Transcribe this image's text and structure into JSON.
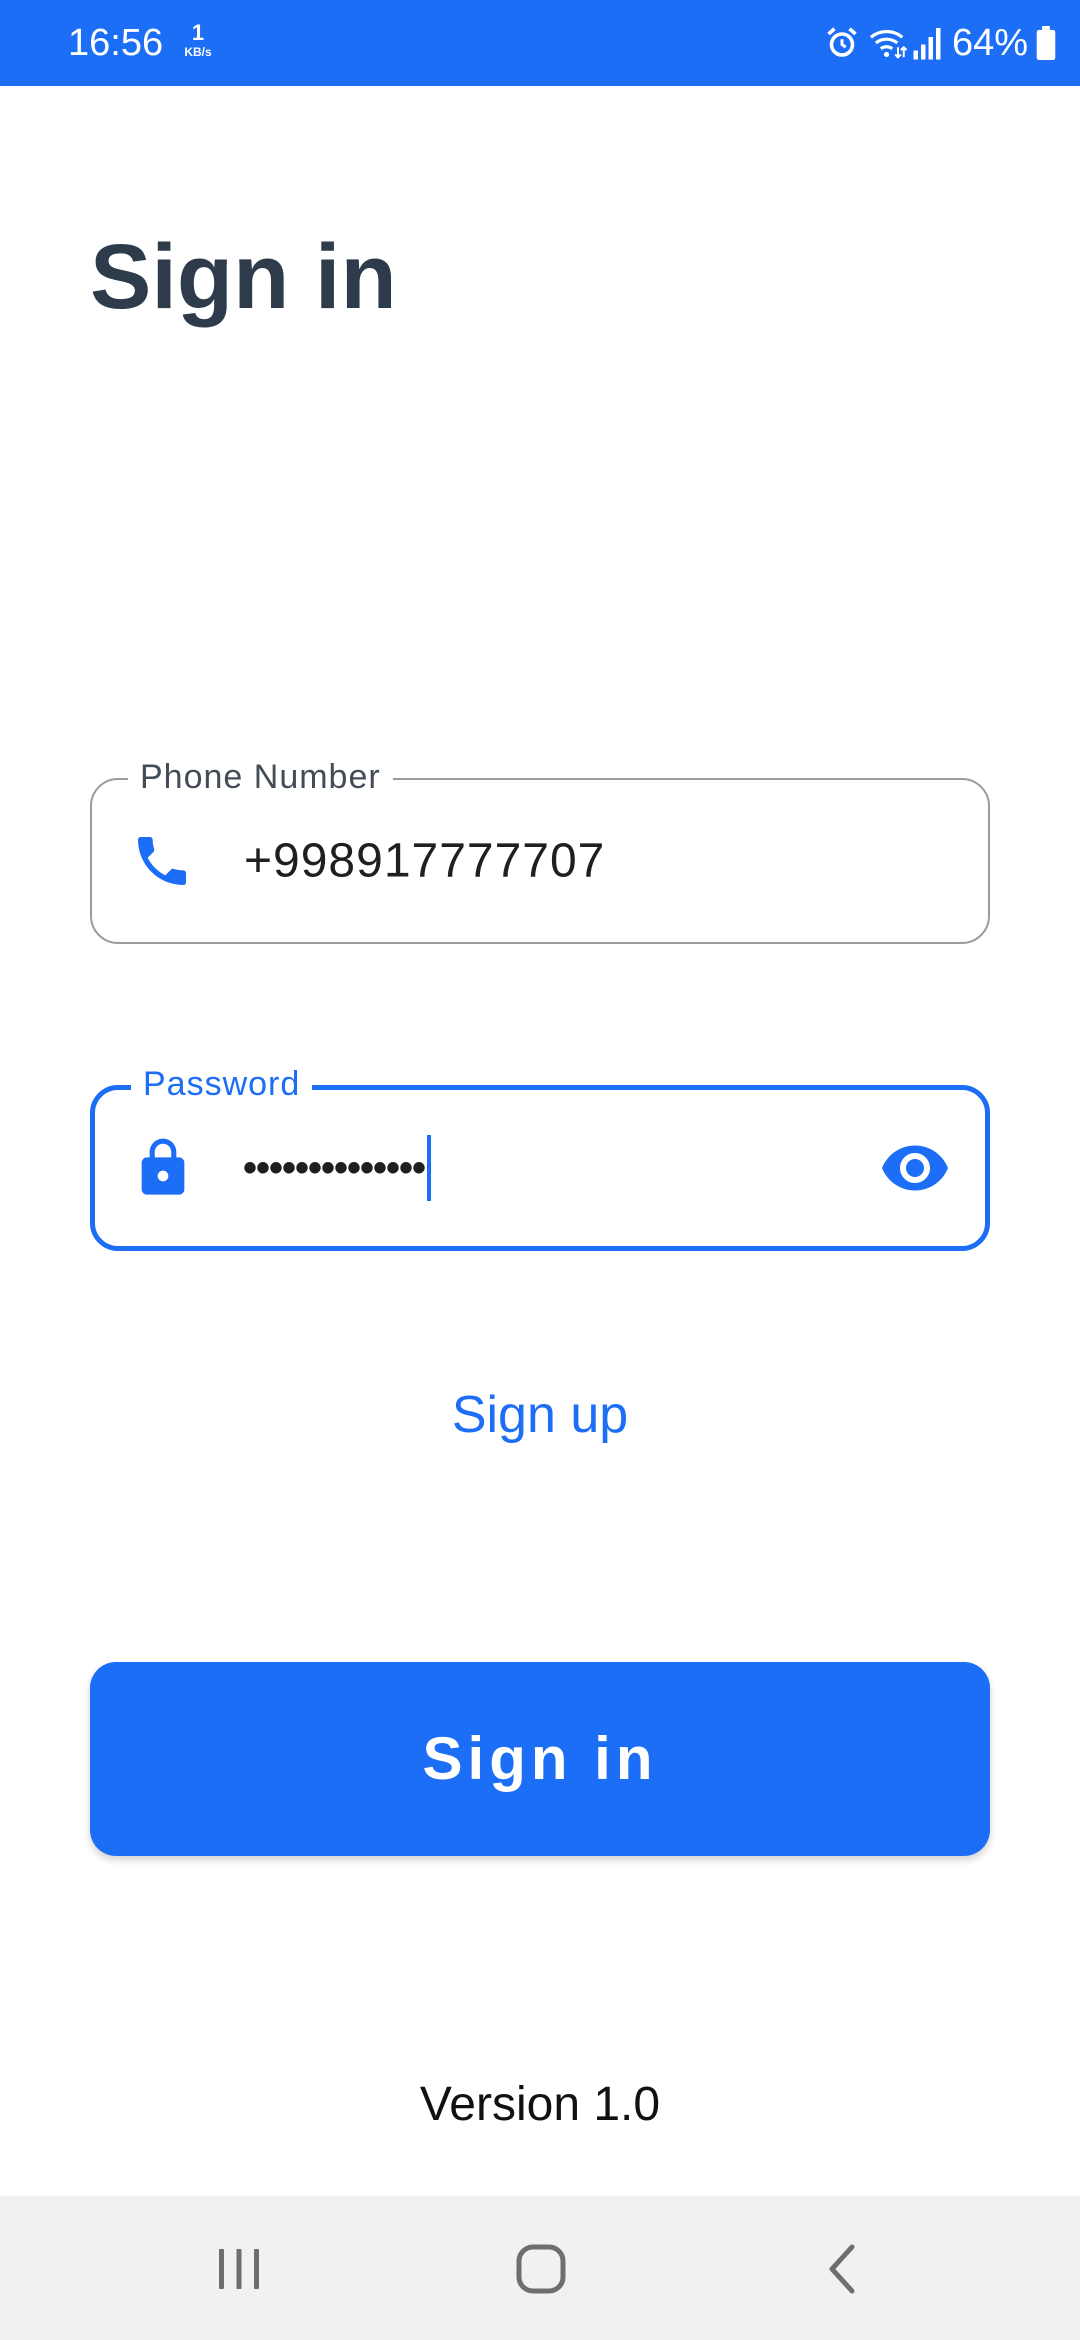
{
  "status_bar": {
    "time": "16:56",
    "net_speed_value": "1",
    "net_speed_unit": "KB/s",
    "battery": "64%"
  },
  "page": {
    "title": "Sign in"
  },
  "phone_field": {
    "label": "Phone Number",
    "value": "+998917777707",
    "icon": "phone-icon"
  },
  "password_field": {
    "label": "Password",
    "masked_value": "••••••••••••••",
    "icon": "lock-icon",
    "toggle_icon": "eye-icon"
  },
  "signup_link": "Sign up",
  "signin_button": "Sign in",
  "version": "Version 1.0",
  "colors": {
    "primary": "#1b6ef5",
    "title": "#2d3b4a",
    "nav_bar": "#f1f1f1"
  }
}
